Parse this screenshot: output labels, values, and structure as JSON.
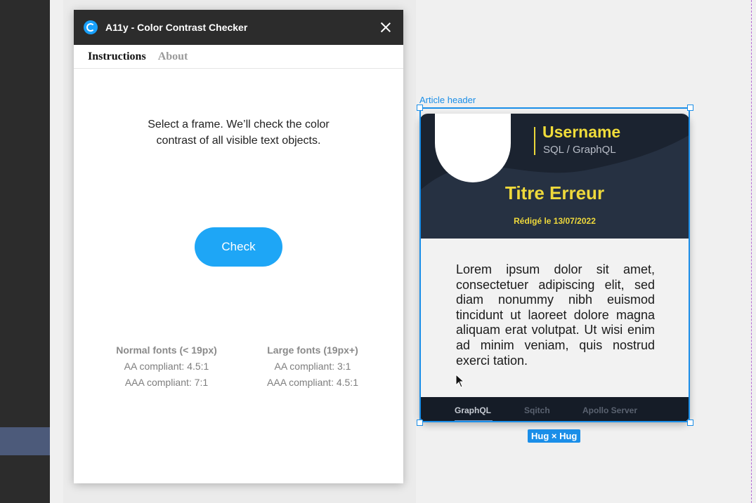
{
  "plugin": {
    "title": "A11y - Color Contrast Checker",
    "tabs": [
      {
        "label": "Instructions",
        "active": true
      },
      {
        "label": "About",
        "active": false
      }
    ],
    "instructions_line1": "Select a frame. We’ll check the color",
    "instructions_line2": "contrast of all visible text objects.",
    "check_label": "Check",
    "legend": {
      "normal": {
        "heading": "Normal fonts (< 19px)",
        "aa": "AA compliant: 4.5:1",
        "aaa": "AAA compliant: 7:1"
      },
      "large": {
        "heading": "Large fonts (19px+)",
        "aa": "AA compliant: 3:1",
        "aaa": "AAA compliant: 4.5:1"
      }
    },
    "accent": "#1ea6f6"
  },
  "canvas": {
    "frame_label": "Article header",
    "size_badge": "Hug × Hug",
    "card": {
      "username": "Username",
      "role": "SQL / GraphQL",
      "title": "Titre Erreur",
      "date": "Rédigé le 13/07/2022",
      "body": "Lorem ipsum dolor sit amet, consectetuer adipiscing elit, sed diam nonummy nibh euismod tincidunt ut laoreet dolore magna aliquam erat volutpat. Ut wisi enim ad minim veniam, quis nostrud exerci tation.",
      "tabs": [
        "GraphQL",
        "Sqitch",
        "Apollo Server"
      ],
      "active_tab": "GraphQL",
      "accent": "#efd93b",
      "header_bg": "#1b2330"
    }
  }
}
